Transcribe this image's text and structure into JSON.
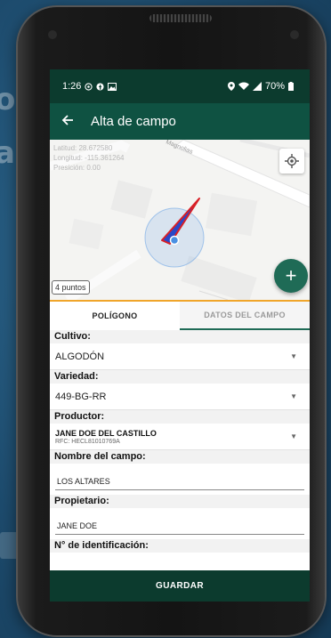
{
  "status_bar": {
    "time": "1:26",
    "battery": "70%",
    "left_icons": [
      "whatsapp-icon",
      "facebook-icon",
      "gallery-icon"
    ],
    "right_icons": [
      "location-icon",
      "wifi-icon",
      "signal-icon",
      "battery-icon"
    ]
  },
  "app_bar": {
    "title": "Alta de campo"
  },
  "map": {
    "latitude_label": "Latitud:",
    "latitude_value": "28.672580",
    "longitude_label": "Longitud:",
    "longitude_value": "-115.361264",
    "precision_label": "Presición:",
    "precision_value": "0.00",
    "street_label": "Magnolias",
    "points_badge": "4 puntos"
  },
  "tabs": [
    {
      "label": "POLÍGONO",
      "active": true
    },
    {
      "label": "DATOS DEL CAMPO",
      "active": false
    }
  ],
  "form": {
    "crop": {
      "label": "Cultivo:",
      "value": "ALGODÓN"
    },
    "variety": {
      "label": "Variedad:",
      "value": "449-BG-RR"
    },
    "producer": {
      "label": "Productor:",
      "name": "JANE DOE DEL CASTILLO",
      "rfc": "RFC: HECL81010769A"
    },
    "field_name": {
      "label": "Nombre del campo:",
      "value": "LOS ALTARES"
    },
    "owner": {
      "label": "Propietario:",
      "value": "JANE DOE"
    },
    "id_number": {
      "label": "N° de identificación:"
    }
  },
  "save_button": {
    "label": "GUARDAR"
  },
  "colors": {
    "status_bar": "#0c3b2e",
    "app_bar": "#0f5242",
    "accent": "#1f6b56",
    "divider": "#f0a52a",
    "polygon": "#d81f26",
    "accuracy_circle": "#4a90e2"
  }
}
